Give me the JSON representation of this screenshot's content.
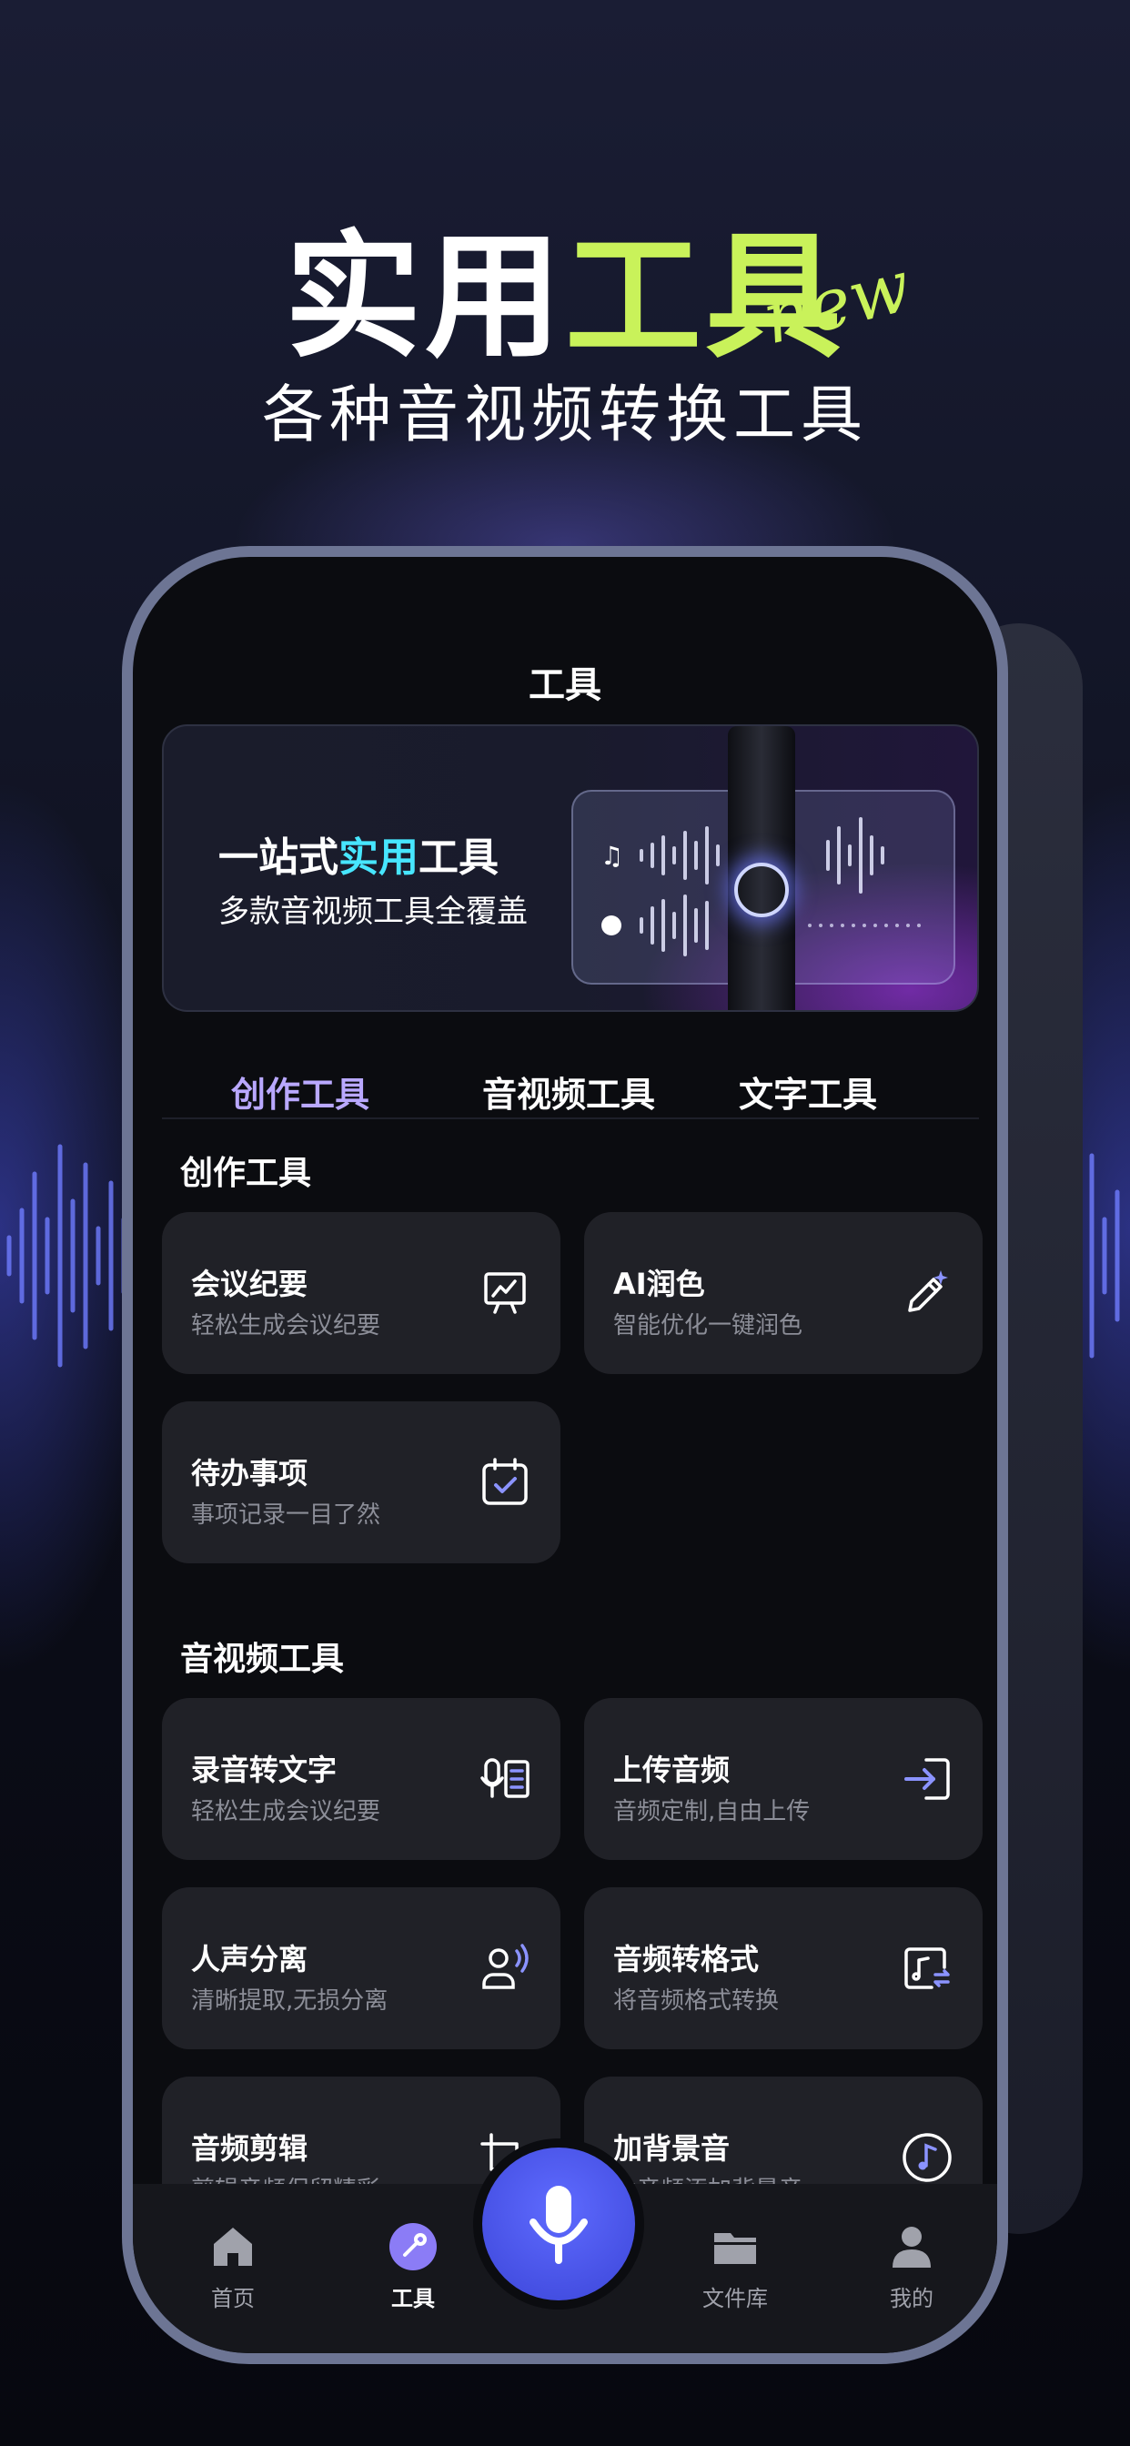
{
  "header": {
    "title_white": "实用",
    "title_green": "工具",
    "badge": "new",
    "subtitle": "各种音视频转换工具"
  },
  "screen": {
    "title": "工具"
  },
  "banner": {
    "line1_a": "一站式",
    "line1_accent": "实用",
    "line1_b": "工具",
    "line2": "多款音视频工具全覆盖"
  },
  "tabs": [
    {
      "label": "创作工具",
      "active": true
    },
    {
      "label": "音视频工具",
      "active": false
    },
    {
      "label": "文字工具",
      "active": false
    }
  ],
  "sections": {
    "creation": {
      "title": "创作工具",
      "cards": [
        {
          "title": "会议纪要",
          "subtitle": "轻松生成会议纪要",
          "icon": "presentation-icon"
        },
        {
          "title": "AI润色",
          "subtitle": "智能优化一键润色",
          "icon": "magic-pen-icon"
        },
        {
          "title": "待办事项",
          "subtitle": "事项记录一目了然",
          "icon": "calendar-check-icon"
        }
      ]
    },
    "audio_video": {
      "title": "音视频工具",
      "cards": [
        {
          "title": "录音转文字",
          "subtitle": "轻松生成会议纪要",
          "icon": "mic-to-text-icon"
        },
        {
          "title": "上传音频",
          "subtitle": "音频定制,自由上传",
          "icon": "upload-icon"
        },
        {
          "title": "人声分离",
          "subtitle": "清晰提取,无损分离",
          "icon": "voice-person-icon"
        },
        {
          "title": "音频转格式",
          "subtitle": "将音频格式转换",
          "icon": "audio-convert-icon"
        },
        {
          "title": "音频剪辑",
          "subtitle": "剪辑音频保留精彩",
          "icon": "crop-icon"
        },
        {
          "title": "加背景音",
          "subtitle": "为音频添加背景音",
          "icon": "music-note-icon"
        }
      ]
    }
  },
  "nav": [
    {
      "label": "首页",
      "icon": "home-icon",
      "active": false
    },
    {
      "label": "工具",
      "icon": "tools-icon",
      "active": true
    },
    {
      "label": "文件库",
      "icon": "folder-icon",
      "active": false
    },
    {
      "label": "我的",
      "icon": "user-icon",
      "active": false
    }
  ],
  "colors": {
    "accent_green": "#c9f25a",
    "tab_active": "#b9a8ff",
    "fab_blue": "#4a55e8",
    "card_bg": "#202127"
  }
}
